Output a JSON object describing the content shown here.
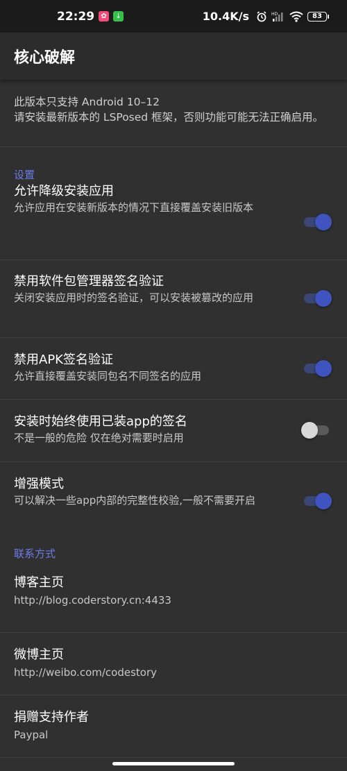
{
  "status_bar": {
    "time": "22:29",
    "net_speed": "10.4K/s",
    "battery_level": "83",
    "icons": [
      "notification-app-icon",
      "download-icon",
      "alarm-icon",
      "hd-signal-icon",
      "wifi-icon",
      "battery-icon"
    ]
  },
  "toolbar": {
    "title": "核心破解"
  },
  "notice": {
    "line1": "此版本只支持 Android 10–12",
    "line2": "请安装最新版本的 LSPosed 框架，否则功能可能无法正确启用。"
  },
  "settings": {
    "header": "设置",
    "items": [
      {
        "title": "允许降级安装应用",
        "summary": "允许应用在安装新版本的情况下直接覆盖安装旧版本",
        "enabled": true
      },
      {
        "title": "禁用软件包管理器签名验证",
        "summary": "关闭安装应用时的签名验证，可以安装被篡改的应用",
        "enabled": true
      },
      {
        "title": "禁用APK签名验证",
        "summary": "允许直接覆盖安装同包名不同签名的应用",
        "enabled": true
      },
      {
        "title": "安装时始终使用已装app的签名",
        "summary": "不是一般的危险 仅在绝对需要时启用",
        "enabled": false
      },
      {
        "title": "增强模式",
        "summary": "可以解决一些app内部的完整性校验,一般不需要开启",
        "enabled": true
      }
    ]
  },
  "contact": {
    "header": "联系方式",
    "items": [
      {
        "title": "博客主页",
        "summary": "http://blog.coderstory.cn:4433"
      },
      {
        "title": "微博主页",
        "summary": "http://weibo.com/codestory"
      },
      {
        "title": "捐赠支持作者",
        "summary": "Paypal"
      }
    ]
  },
  "colors": {
    "accent": "#4054c0",
    "section_header": "#6b7de8",
    "background": "#303030"
  }
}
